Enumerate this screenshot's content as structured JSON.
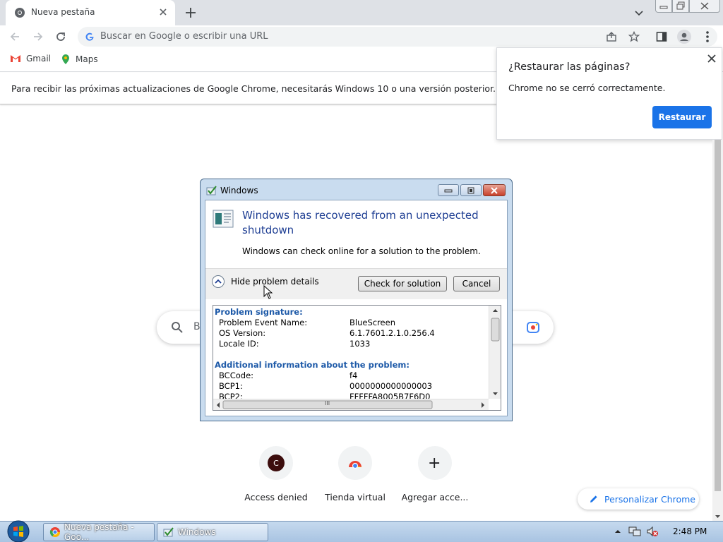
{
  "browser": {
    "tab_title": "Nueva pestaña",
    "omnibox_placeholder": "Buscar en Google o escribir una URL",
    "bookmarks": [
      {
        "label": "Gmail",
        "icon": "gmail-icon"
      },
      {
        "label": "Maps",
        "icon": "maps-icon"
      }
    ],
    "infobar_text": "Para recibir las próximas actualizaciones de Google Chrome, necesitarás Windows 10 o una versión posterior. Esta comp"
  },
  "restore_popup": {
    "title": "¿Restaurar las páginas?",
    "message": "Chrome no se cerró correctamente.",
    "button": "Restaurar"
  },
  "ntp": {
    "search_partial": "B",
    "shortcuts": [
      {
        "label": "Access denied",
        "letter": "C"
      },
      {
        "label": "Tienda virtual",
        "letter": ""
      },
      {
        "label": "Agregar acce...",
        "letter": "+"
      }
    ],
    "customize": "Personalizar Chrome"
  },
  "dialog": {
    "window_title": "Windows",
    "heading": "Windows has recovered from an unexpected shutdown",
    "subtext": "Windows can check online for a solution to the problem.",
    "toggle": "Hide problem details",
    "check_button": "Check for solution",
    "cancel_button": "Cancel",
    "details": {
      "section1": "Problem signature:",
      "rows1": [
        {
          "k": "Problem Event Name:",
          "v": "BlueScreen"
        },
        {
          "k": "OS Version:",
          "v": "6.1.7601.2.1.0.256.4"
        },
        {
          "k": "Locale ID:",
          "v": "1033"
        }
      ],
      "section2": "Additional information about the problem:",
      "rows2": [
        {
          "k": "BCCode:",
          "v": "f4"
        },
        {
          "k": "BCP1:",
          "v": "0000000000000003"
        },
        {
          "k": "BCP2:",
          "v": "FFFFFA8005B7F6D0"
        }
      ],
      "hscroll_grip": "III"
    }
  },
  "taskbar": {
    "items": [
      {
        "label": "Nueva pestaña - Goo..."
      },
      {
        "label": "Windows"
      }
    ],
    "clock": "2:48 PM"
  },
  "colors": {
    "accent": "#1a73e8",
    "dialog_heading": "#1e3e93",
    "details_section": "#1e5aa8"
  }
}
